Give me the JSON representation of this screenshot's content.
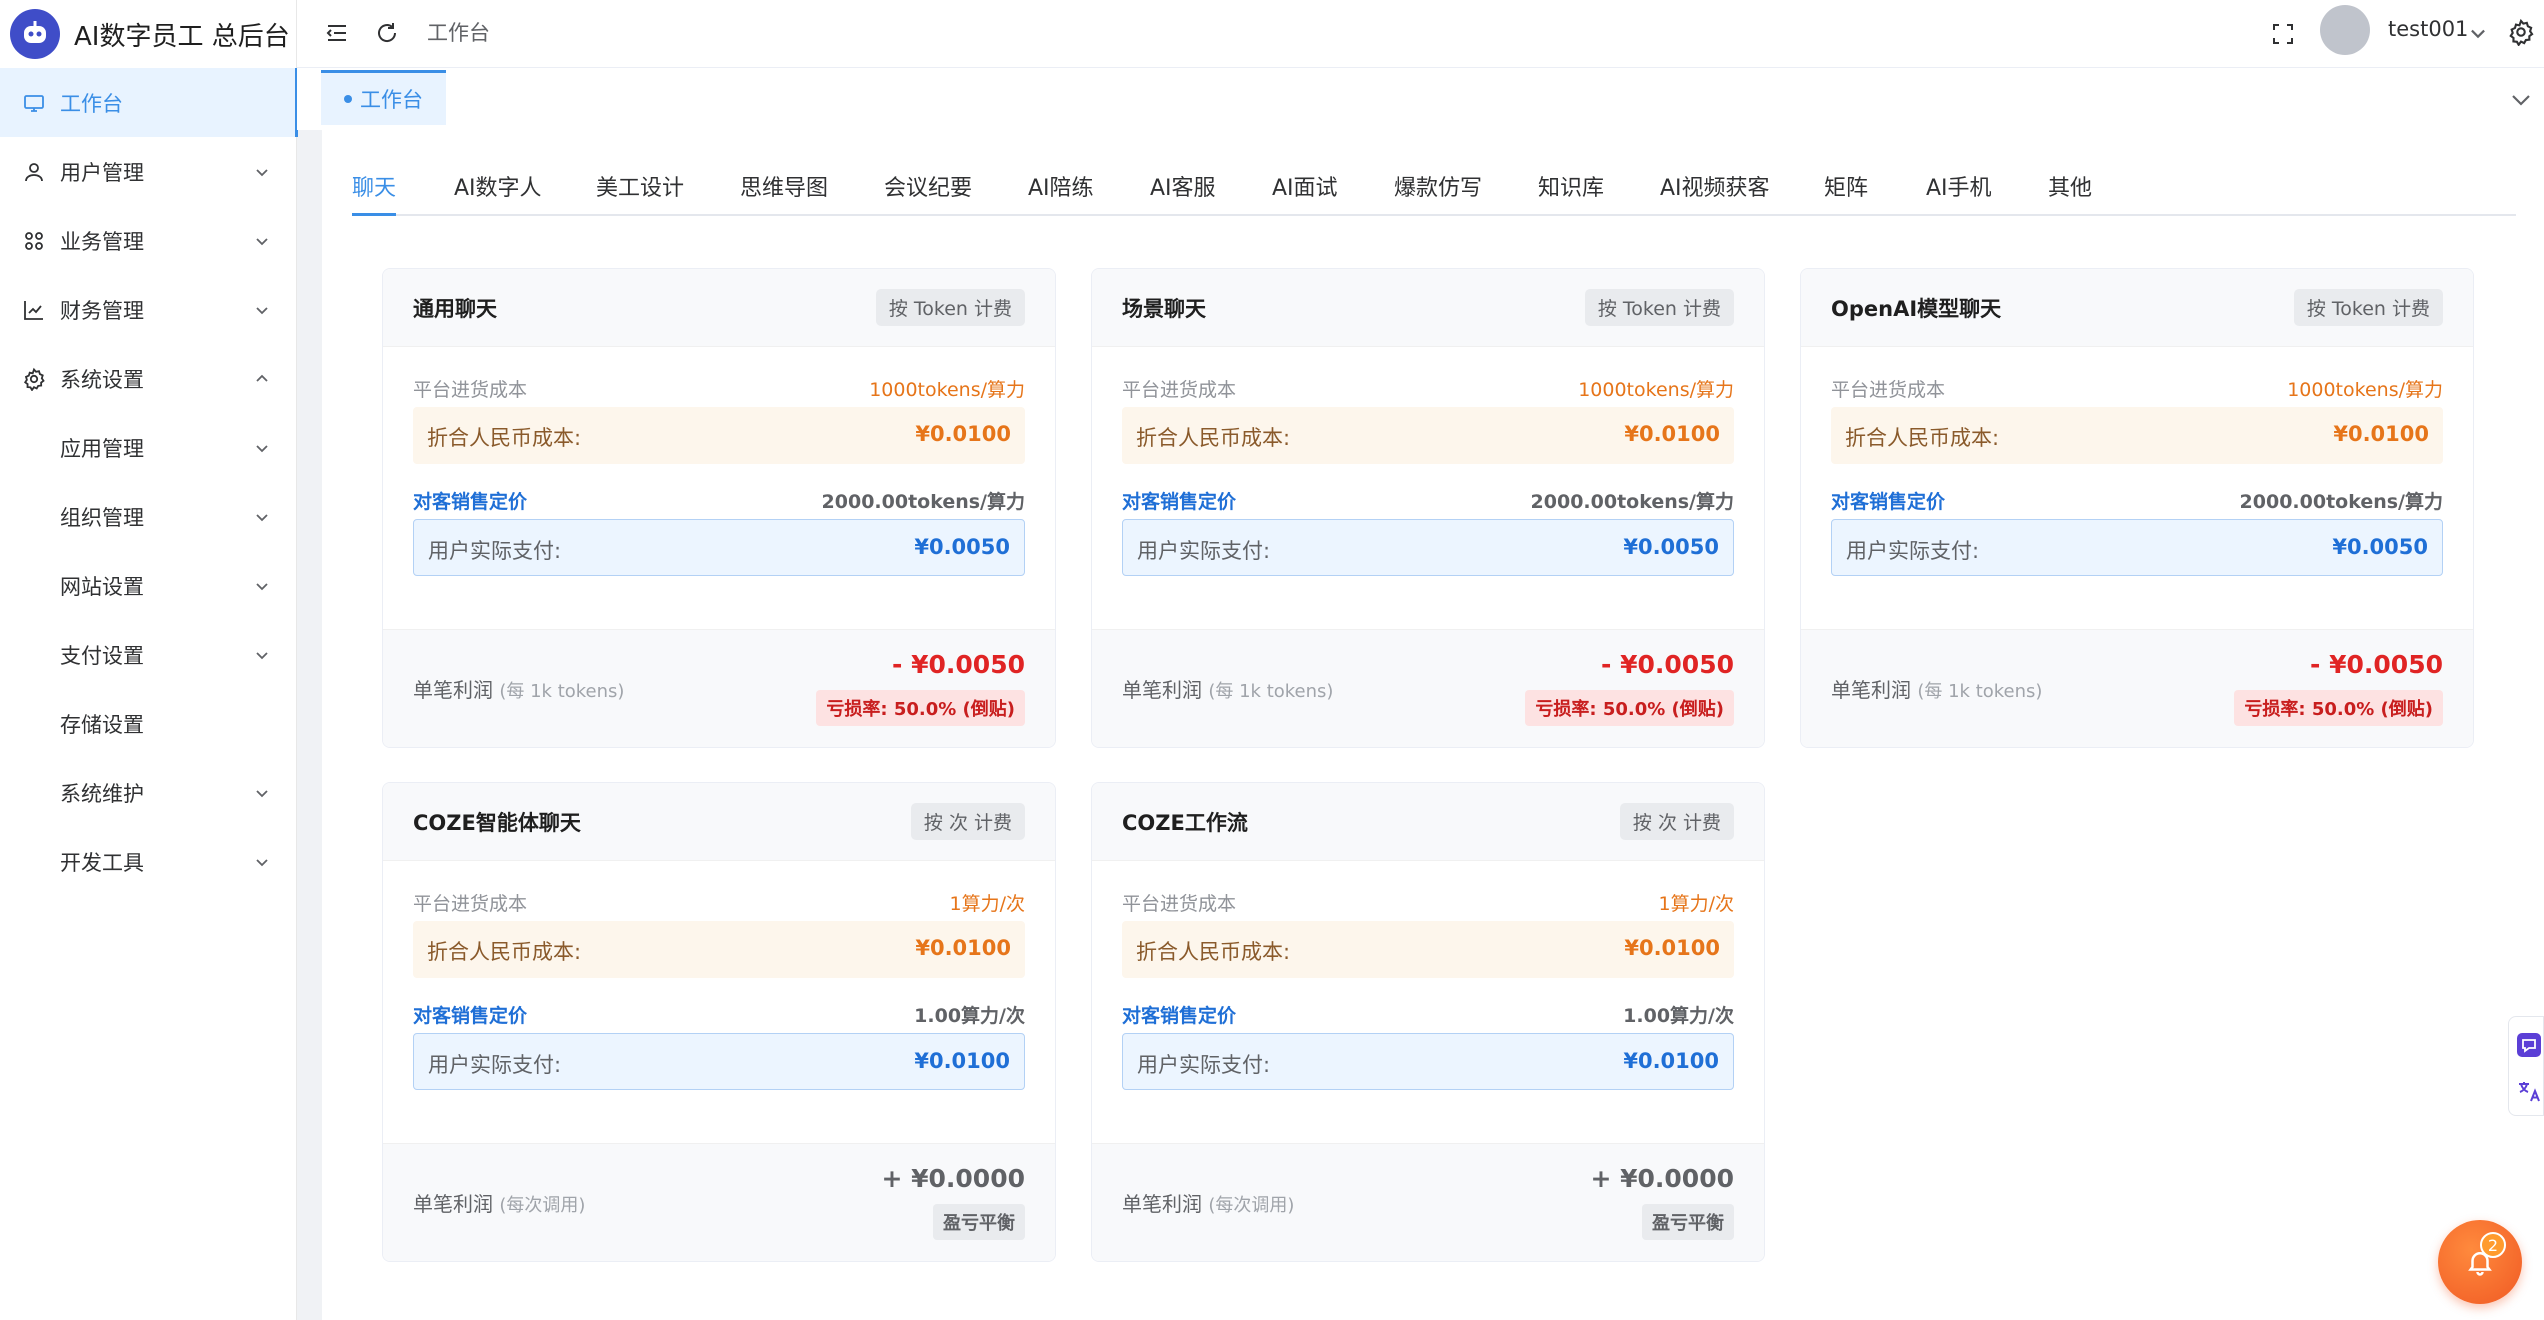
{
  "brand": {
    "title": "AI数字员工 总后台"
  },
  "sidebar": {
    "items": [
      {
        "label": "工作台"
      },
      {
        "label": "用户管理"
      },
      {
        "label": "业务管理"
      },
      {
        "label": "财务管理"
      },
      {
        "label": "系统设置"
      },
      {
        "label": "应用管理"
      },
      {
        "label": "组织管理"
      },
      {
        "label": "网站设置"
      },
      {
        "label": "支付设置"
      },
      {
        "label": "存储设置"
      },
      {
        "label": "系统维护"
      },
      {
        "label": "开发工具"
      }
    ]
  },
  "topbar": {
    "breadcrumb": "工作台",
    "username": "test001"
  },
  "tagsbar": {
    "active_tag": "工作台"
  },
  "tabs": [
    "聊天",
    "AI数字人",
    "美工设计",
    "思维导图",
    "会议纪要",
    "AI陪练",
    "AI客服",
    "AI面试",
    "爆款仿写",
    "知识库",
    "AI视频获客",
    "矩阵",
    "AI手机",
    "其他"
  ],
  "cards": [
    {
      "title": "通用聊天",
      "billing": "按 Token 计费",
      "cost_label": "平台进货成本",
      "cost_rate": "1000tokens/算力",
      "rmb_label": "折合人民币成本:",
      "rmb_value": "¥0.0100",
      "sell_label": "对客销售定价",
      "sell_rate": "2000.00tokens/算力",
      "pay_label": "用户实际支付:",
      "pay_value": "¥0.0050",
      "profit_label": "单笔利润",
      "profit_unit": "(每 1k tokens)",
      "profit_value": "- ¥0.0050",
      "badge": "亏损率: 50.0% (倒贴)"
    },
    {
      "title": "场景聊天",
      "billing": "按 Token 计费",
      "cost_label": "平台进货成本",
      "cost_rate": "1000tokens/算力",
      "rmb_label": "折合人民币成本:",
      "rmb_value": "¥0.0100",
      "sell_label": "对客销售定价",
      "sell_rate": "2000.00tokens/算力",
      "pay_label": "用户实际支付:",
      "pay_value": "¥0.0050",
      "profit_label": "单笔利润",
      "profit_unit": "(每 1k tokens)",
      "profit_value": "- ¥0.0050",
      "badge": "亏损率: 50.0% (倒贴)"
    },
    {
      "title": "OpenAI模型聊天",
      "billing": "按 Token 计费",
      "cost_label": "平台进货成本",
      "cost_rate": "1000tokens/算力",
      "rmb_label": "折合人民币成本:",
      "rmb_value": "¥0.0100",
      "sell_label": "对客销售定价",
      "sell_rate": "2000.00tokens/算力",
      "pay_label": "用户实际支付:",
      "pay_value": "¥0.0050",
      "profit_label": "单笔利润",
      "profit_unit": "(每 1k tokens)",
      "profit_value": "- ¥0.0050",
      "badge": "亏损率: 50.0% (倒贴)"
    },
    {
      "title": "COZE智能体聊天",
      "billing": "按 次 计费",
      "cost_label": "平台进货成本",
      "cost_rate": "1算力/次",
      "rmb_label": "折合人民币成本:",
      "rmb_value": "¥0.0100",
      "sell_label": "对客销售定价",
      "sell_rate": "1.00算力/次",
      "pay_label": "用户实际支付:",
      "pay_value": "¥0.0100",
      "profit_label": "单笔利润",
      "profit_unit": "(每次调用)",
      "profit_value": "+ ¥0.0000",
      "badge": "盈亏平衡"
    },
    {
      "title": "COZE工作流",
      "billing": "按 次 计费",
      "cost_label": "平台进货成本",
      "cost_rate": "1算力/次",
      "rmb_label": "折合人民币成本:",
      "rmb_value": "¥0.0100",
      "sell_label": "对客销售定价",
      "sell_rate": "1.00算力/次",
      "pay_label": "用户实际支付:",
      "pay_value": "¥0.0100",
      "profit_label": "单笔利润",
      "profit_unit": "(每次调用)",
      "profit_value": "+ ¥0.0000",
      "badge": "盈亏平衡"
    }
  ],
  "notification": {
    "count": "2"
  },
  "colors": {
    "accent": "#3a8ee6",
    "loss": "#e02424",
    "cost": "#e6751a",
    "pay": "#1f6fd6"
  }
}
